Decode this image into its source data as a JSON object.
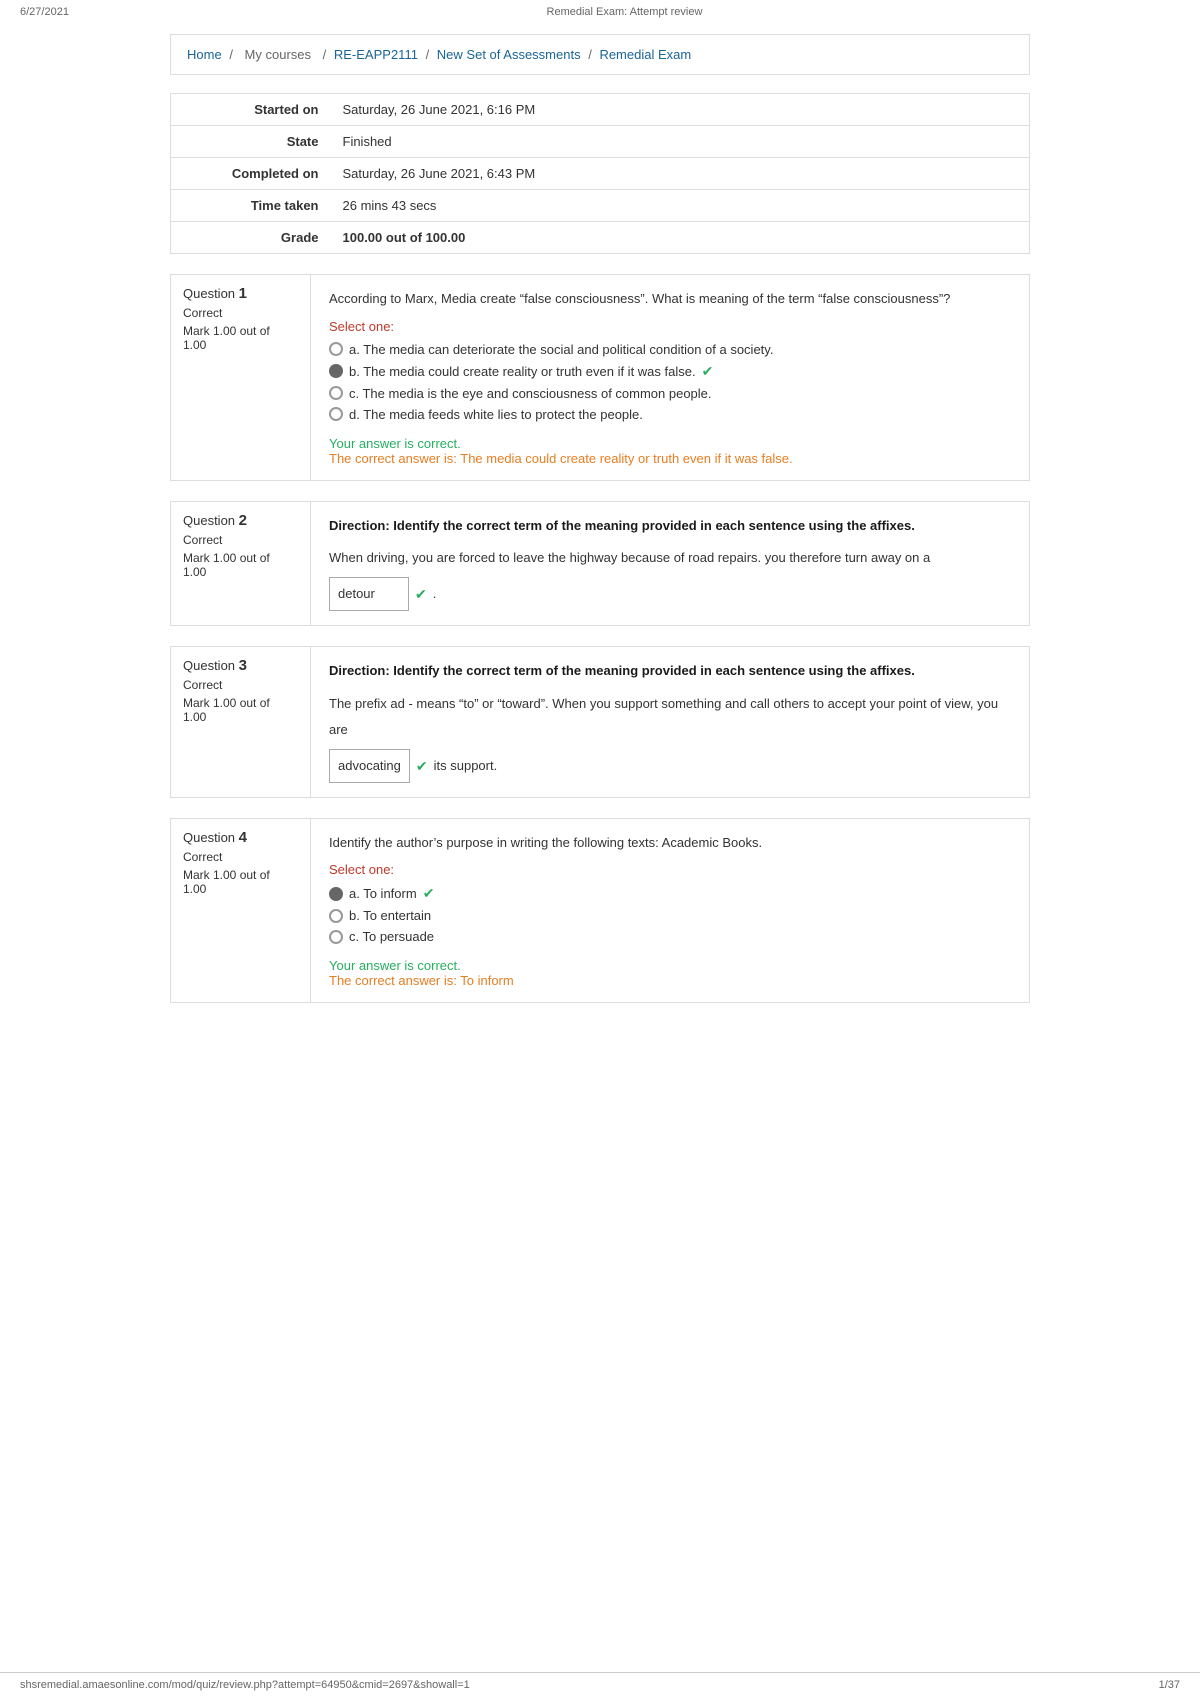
{
  "topbar": {
    "date": "6/27/2021",
    "page_title": "Remedial Exam: Attempt review",
    "page_num": "1/37"
  },
  "breadcrumb": {
    "home": "Home",
    "separator1": "/",
    "mycourses": "My courses",
    "separator2": "/",
    "course_code": "RE-EAPP2111",
    "separator3": "/",
    "assessment_set": "New Set of Assessments",
    "separator4": "/",
    "exam": "Remedial Exam"
  },
  "info": {
    "started_on_label": "Started on",
    "started_on_value": "Saturday, 26 June 2021, 6:16 PM",
    "state_label": "State",
    "state_value": "Finished",
    "completed_on_label": "Completed on",
    "completed_on_value": "Saturday, 26 June 2021, 6:43 PM",
    "time_taken_label": "Time taken",
    "time_taken_value": "26 mins 43 secs",
    "grade_label": "Grade",
    "grade_value": "100.00 out of 100.00"
  },
  "questions": [
    {
      "number": "1",
      "status": "Correct",
      "mark": "Mark 1.00 out of",
      "mark2": "1.00",
      "type": "mcq",
      "question": "According to Marx, Media create “false consciousness”. What is meaning of the term “false consciousness”?",
      "select_label": "Select one:",
      "options": [
        {
          "id": "a",
          "text": "a.  The media can deteriorate the social and political condition of a society.",
          "selected": false,
          "correct": false
        },
        {
          "id": "b",
          "text": "b.  The media could create reality or truth even if it was false.",
          "selected": true,
          "correct": true
        },
        {
          "id": "c",
          "text": "c.  The media is the eye and consciousness of common people.",
          "selected": false,
          "correct": false
        },
        {
          "id": "d",
          "text": "d.  The media feeds white lies to protect the people.",
          "selected": false,
          "correct": false
        }
      ],
      "feedback_correct": "Your answer is correct.",
      "feedback_answer": "The correct answer is:  The media could create reality or truth even if it was false."
    },
    {
      "number": "2",
      "status": "Correct",
      "mark": "Mark 1.00 out of",
      "mark2": "1.00",
      "type": "fillblank",
      "direction": "Direction: Identify the correct term of the meaning provided in each sentence using the affixes.",
      "question_text": "When driving, you are forced to leave the highway because of road repairs. you therefore turn away on a",
      "blank_answer": "detour",
      "after_blank": "."
    },
    {
      "number": "3",
      "status": "Correct",
      "mark": "Mark 1.00 out of",
      "mark2": "1.00",
      "type": "fillblank",
      "direction": "Direction: Identify the correct term of the meaning provided in each sentence using the affixes.",
      "question_text": "The prefix ad - means “to” or “toward”. When you support something and call others to accept your point of view, you are",
      "blank_answer": "advocating",
      "after_blank": "its support."
    },
    {
      "number": "4",
      "status": "Correct",
      "mark": "Mark 1.00 out of",
      "mark2": "1.00",
      "type": "mcq",
      "question": "Identify the author’s purpose in writing the following texts: Academic Books.",
      "select_label": "Select one:",
      "options": [
        {
          "id": "a",
          "text": "a.  To inform",
          "selected": true,
          "correct": true
        },
        {
          "id": "b",
          "text": "b.  To entertain",
          "selected": false,
          "correct": false
        },
        {
          "id": "c",
          "text": "c.  To persuade",
          "selected": false,
          "correct": false
        }
      ],
      "feedback_correct": "Your answer is correct.",
      "feedback_answer": "The correct answer is: To inform"
    }
  ],
  "footer": {
    "url": "shsremedial.amaesonline.com/mod/quiz/review.php?attempt=64950&cmid=2697&showall=1",
    "page_num": "1/37"
  }
}
